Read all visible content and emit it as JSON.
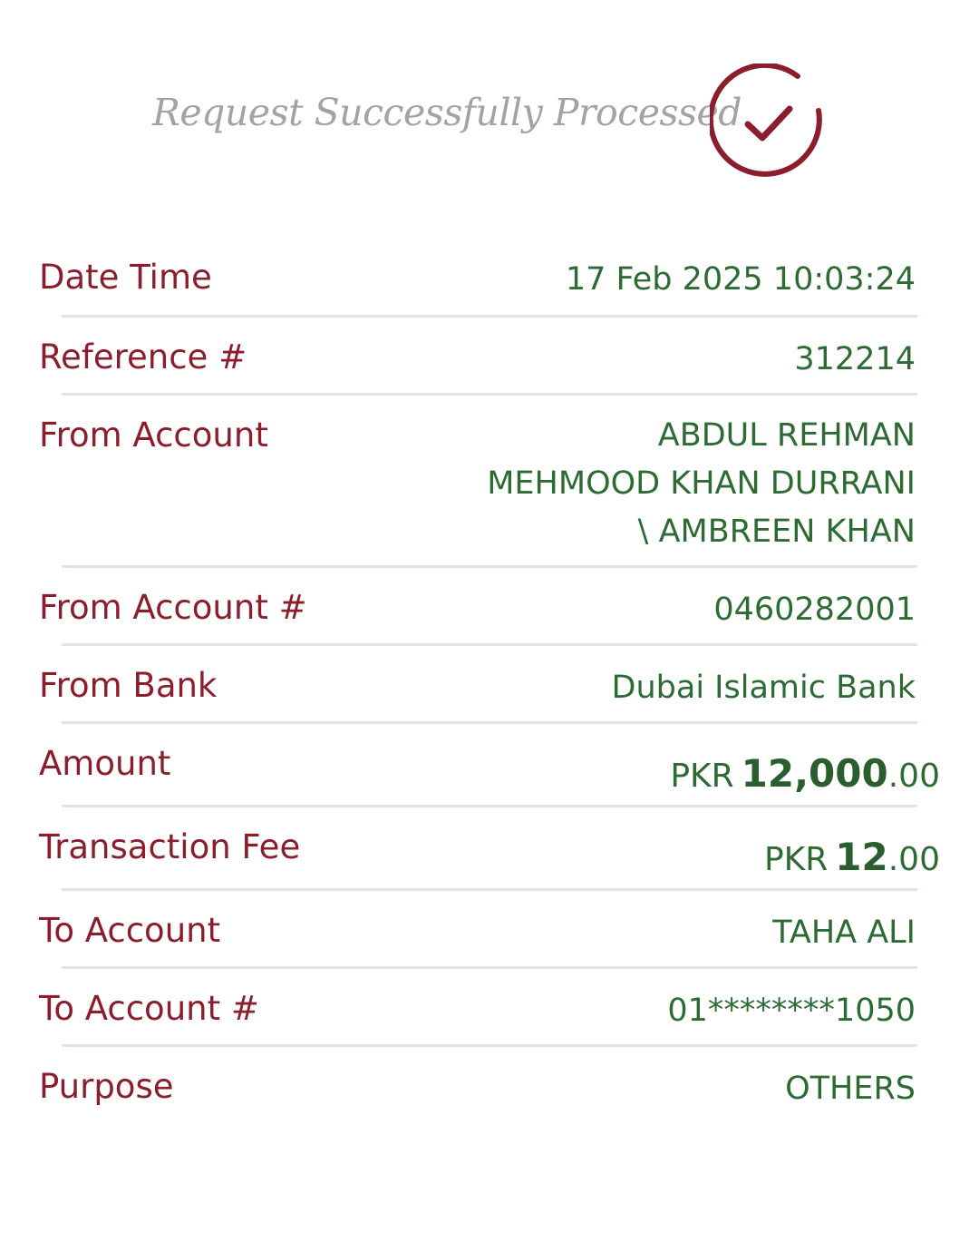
{
  "header": {
    "title": "Request Successfully Processed",
    "icon": "check-circle-icon",
    "accent_color": "#8a1e2d"
  },
  "colors": {
    "label": "#8a1e2d",
    "value": "#2e6b34",
    "divider": "#dfe4ec"
  },
  "rows": {
    "date_time": {
      "label": "Date Time",
      "value": "17 Feb 2025 10:03:24"
    },
    "reference": {
      "label": "Reference #",
      "value": "312214"
    },
    "from_account": {
      "label": "From Account",
      "lines": [
        "ABDUL REHMAN",
        "MEHMOOD KHAN DURRANI",
        "\\ AMBREEN KHAN"
      ]
    },
    "from_account_no": {
      "label": "From Account #",
      "value": "0460282001"
    },
    "from_bank": {
      "label": "From Bank",
      "value": "Dubai Islamic Bank"
    },
    "amount": {
      "label": "Amount",
      "currency": "PKR",
      "whole": "12,000",
      "decimal": ".00"
    },
    "fee": {
      "label": "Transaction Fee",
      "currency": "PKR",
      "whole": "12",
      "decimal": ".00"
    },
    "to_account": {
      "label": "To Account",
      "value": "TAHA ALI"
    },
    "to_account_no": {
      "label": "To Account #",
      "value": "01********1050"
    },
    "purpose": {
      "label": "Purpose",
      "value": "OTHERS"
    }
  }
}
